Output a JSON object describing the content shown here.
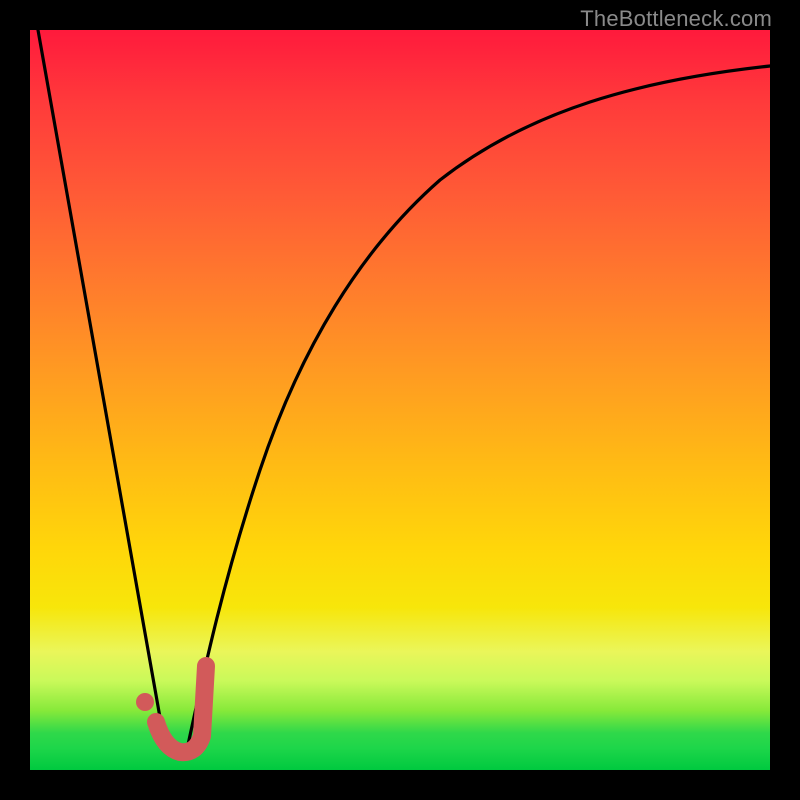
{
  "watermark": "TheBottleneck.com",
  "colors": {
    "frame": "#000000",
    "curve": "#000000",
    "marker_stroke": "#d25a5a",
    "marker_fill": "#d25a5a",
    "gradient_top": "#ff1a3c",
    "gradient_bottom": "#00c93f"
  },
  "chart_data": {
    "type": "line",
    "title": "",
    "xlabel": "",
    "ylabel": "",
    "xlim": [
      0,
      100
    ],
    "ylim": [
      0,
      100
    ],
    "series": [
      {
        "name": "left-branch",
        "x": [
          1,
          18
        ],
        "y": [
          100,
          4
        ],
        "style": "line"
      },
      {
        "name": "right-branch",
        "x": [
          21,
          24,
          28,
          32,
          36,
          40,
          45,
          50,
          55,
          60,
          65,
          70,
          75,
          80,
          85,
          90,
          95,
          100
        ],
        "y": [
          2,
          10,
          22,
          34,
          44,
          53,
          60,
          66,
          71,
          75,
          78.5,
          81.5,
          84,
          86,
          87.5,
          89,
          90,
          91
        ],
        "style": "curve"
      },
      {
        "name": "marker-J",
        "x": [
          17,
          18.5,
          20,
          21,
          22,
          23,
          23.5,
          23.5,
          23.5,
          23.5
        ],
        "y": [
          6.5,
          3.5,
          2.3,
          2.2,
          2.6,
          4,
          6.5,
          9,
          11.5,
          14
        ],
        "style": "thick-path"
      },
      {
        "name": "marker-dot",
        "x": [
          15.5
        ],
        "y": [
          9
        ],
        "style": "dot"
      }
    ],
    "notes": "Axes unlabeled; background vertical gradient red→green encodes magnitude. Curve shows sharp V near x≈18–21 then asymptotic rise. J-shaped marker and dot highlight the minimum region."
  }
}
